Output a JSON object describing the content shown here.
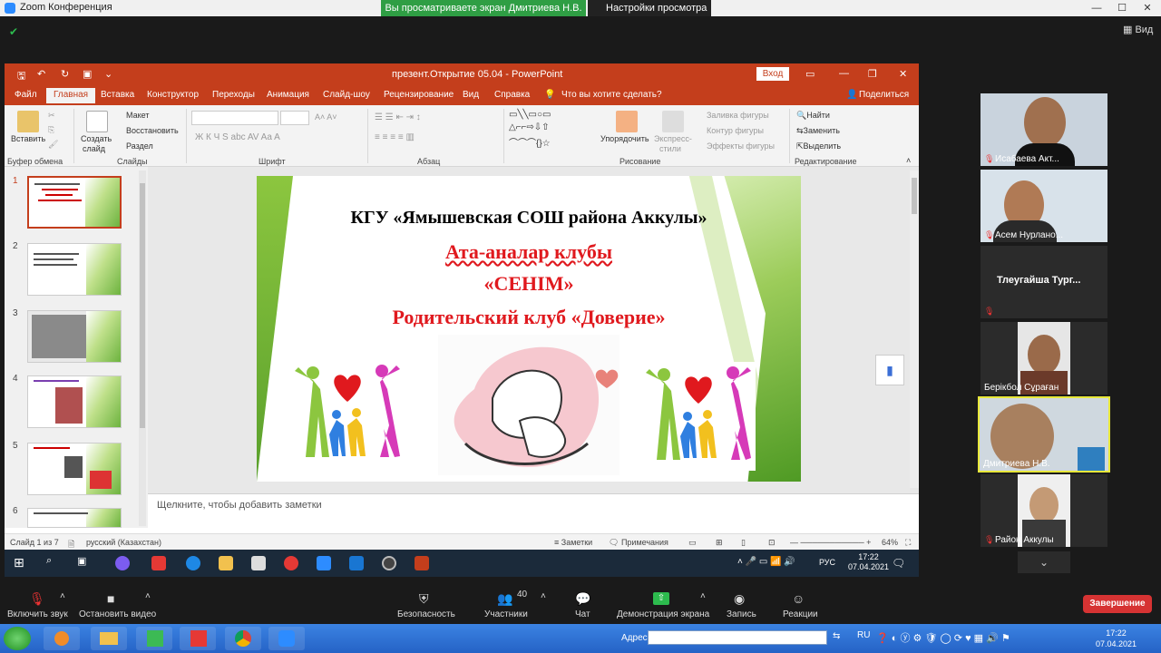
{
  "zoom": {
    "window_title": "Zoom Конференция",
    "share_banner": "Вы просматриваете экран Дмитриева Н.В.",
    "view_options": "Настройки просмотра",
    "view_label": "Вид"
  },
  "ppt": {
    "window_title": "презент.Открытие 05.04  -  PowerPoint",
    "login": "Вход",
    "tabs": [
      "Файл",
      "Главная",
      "Вставка",
      "Конструктор",
      "Переходы",
      "Анимация",
      "Слайд-шоу",
      "Рецензирование",
      "Вид",
      "Справка"
    ],
    "tell_me": "Что вы хотите сделать?",
    "share": "Поделиться",
    "ribbon": {
      "paste": "Вставить",
      "clipboard_group": "Буфер обмена",
      "create_slide": "Создать",
      "create_slide_2": "слайд",
      "layout": "Макет",
      "reset": "Восстановить",
      "section": "Раздел",
      "slides_group": "Слайды",
      "font_group": "Шрифт",
      "paragraph_group": "Абзац",
      "arrange": "Упорядочить",
      "quick_styles": "Экспресс-",
      "quick_styles_2": "стили",
      "shape_fill": "Заливка фигуры",
      "shape_outline": "Контур фигуры",
      "shape_effects": "Эффекты фигуры",
      "drawing_group": "Рисование",
      "find": "Найти",
      "replace": "Заменить",
      "select": "Выделить",
      "editing_group": "Редактирование"
    },
    "slide_numbers": [
      "1",
      "2",
      "3",
      "4",
      "5",
      "6"
    ],
    "slide": {
      "school": "КГУ «Ямышевская СОШ района Аккулы»",
      "club_kz": "Ата-аналар клубы",
      "club_name": "«СЕНІМ»",
      "club_ru": "Родительский клуб «Доверие»"
    },
    "notes_placeholder": "Щелкните, чтобы добавить заметки",
    "status": {
      "slide_of": "Слайд 1 из 7",
      "language": "русский (Казахстан)",
      "notes": "Заметки",
      "comments": "Примечания",
      "zoom": "64%"
    }
  },
  "inner_taskbar": {
    "lang": "РУС",
    "time": "17:22",
    "date": "07.04.2021"
  },
  "participants": [
    {
      "name": "Исабаева Акт...",
      "muted": true
    },
    {
      "name": "Асем Нурлано...",
      "muted": true
    },
    {
      "name": "Тлеугайша  Тург...",
      "muted": true
    },
    {
      "name": "Берікбол Сұраған",
      "muted": false
    },
    {
      "name": "Дмитриева Н.В.",
      "muted": false
    },
    {
      "name": "Район Аккулы",
      "muted": true
    }
  ],
  "toolbar": {
    "unmute": "Включить звук",
    "start_video": "Остановить видео",
    "security": "Безопасность",
    "participants": "Участники",
    "participants_count": "40",
    "chat": "Чат",
    "share_screen": "Демонстрация экрана",
    "record": "Запись",
    "reactions": "Реакции",
    "end": "Завершение"
  },
  "outer_taskbar": {
    "address_label": "Адрес",
    "lang": "RU",
    "time": "17:22",
    "date": "07.04.2021"
  },
  "colors": {
    "ppt_accent": "#c43e1c",
    "slide_red": "#e0191e",
    "share_green": "#2f9e44",
    "end_red": "#d63333",
    "active_speaker": "#e8e83a"
  }
}
